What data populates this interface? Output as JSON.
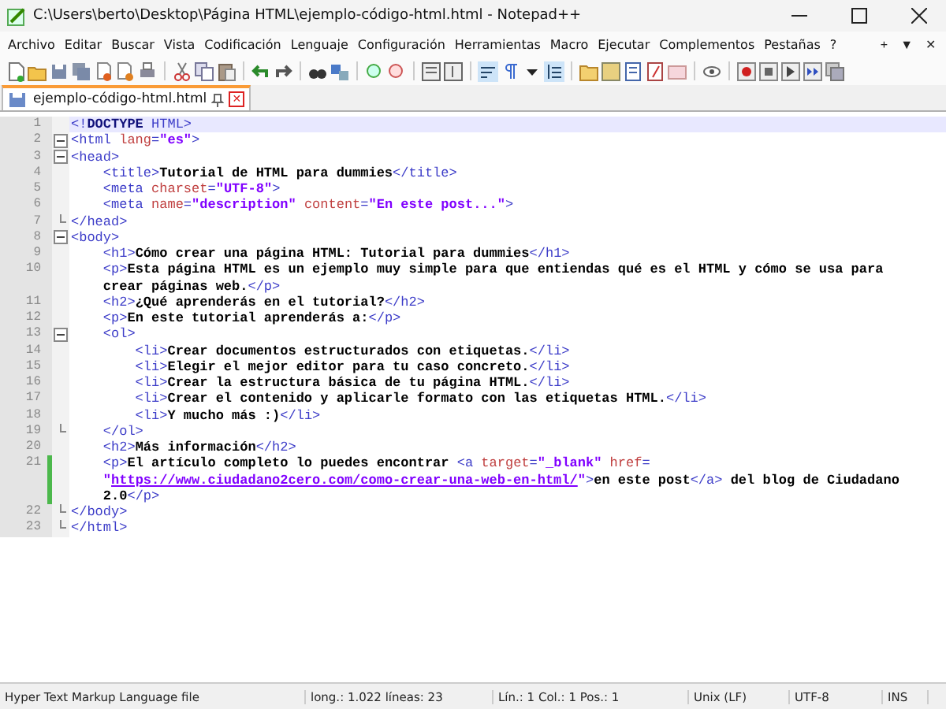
{
  "window": {
    "title": "C:\\Users\\berto\\Desktop\\Página HTML\\ejemplo-código-html.html - Notepad++"
  },
  "menu": [
    "Archivo",
    "Editar",
    "Buscar",
    "Vista",
    "Codificación",
    "Lenguaje",
    "Configuración",
    "Herramientas",
    "Macro",
    "Ejecutar",
    "Complementos",
    "Pestañas",
    "?"
  ],
  "menu_controls": [
    "+",
    "▼",
    "✕"
  ],
  "tabs": [
    {
      "label": "ejemplo-código-html.html",
      "selected": true,
      "pin": "✕"
    }
  ],
  "editor": {
    "lines": [
      {
        "number": "1",
        "current": true,
        "changed": false,
        "fold_start": false,
        "fold_end": false,
        "visual_lines": [
          {
            "segments": [
              {
                "kind": "tag",
                "text": "<!"
              },
              {
                "kind": "doctype",
                "text": "DOCTYPE"
              },
              {
                "kind": "tag",
                "text": " HTML>"
              }
            ]
          }
        ]
      },
      {
        "number": "2",
        "current": false,
        "changed": false,
        "fold_start": true,
        "fold_end": false,
        "visual_lines": [
          {
            "segments": [
              {
                "kind": "tag",
                "text": "<html "
              },
              {
                "kind": "attr",
                "text": "lang"
              },
              {
                "kind": "tag",
                "text": "="
              },
              {
                "kind": "value",
                "text": "\"es\""
              },
              {
                "kind": "tag",
                "text": ">"
              }
            ]
          }
        ]
      },
      {
        "number": "3",
        "current": false,
        "changed": false,
        "fold_start": true,
        "fold_end": false,
        "visual_lines": [
          {
            "segments": [
              {
                "kind": "tag",
                "text": "<head>"
              }
            ]
          }
        ]
      },
      {
        "number": "4",
        "current": false,
        "changed": false,
        "fold_start": false,
        "fold_end": false,
        "visual_lines": [
          {
            "segments": [
              {
                "kind": "tag",
                "text": "    <title>"
              },
              {
                "kind": "text",
                "text": "Tutorial de HTML para dummies"
              },
              {
                "kind": "tag",
                "text": "</title>"
              }
            ]
          }
        ]
      },
      {
        "number": "5",
        "current": false,
        "changed": false,
        "fold_start": false,
        "fold_end": false,
        "visual_lines": [
          {
            "segments": [
              {
                "kind": "tag",
                "text": "    <meta "
              },
              {
                "kind": "attr",
                "text": "charset"
              },
              {
                "kind": "tag",
                "text": "="
              },
              {
                "kind": "value",
                "text": "\"UTF-8\""
              },
              {
                "kind": "tag",
                "text": ">"
              }
            ]
          }
        ]
      },
      {
        "number": "6",
        "current": false,
        "changed": false,
        "fold_start": false,
        "fold_end": false,
        "visual_lines": [
          {
            "segments": [
              {
                "kind": "tag",
                "text": "    <meta "
              },
              {
                "kind": "attr",
                "text": "name"
              },
              {
                "kind": "tag",
                "text": "="
              },
              {
                "kind": "value",
                "text": "\"description\""
              },
              {
                "kind": "attr",
                "text": " content"
              },
              {
                "kind": "tag",
                "text": "="
              },
              {
                "kind": "value",
                "text": "\"En este post...\""
              },
              {
                "kind": "tag",
                "text": ">"
              }
            ]
          }
        ]
      },
      {
        "number": "7",
        "current": false,
        "changed": false,
        "fold_start": false,
        "fold_end": true,
        "visual_lines": [
          {
            "segments": [
              {
                "kind": "tag",
                "text": "</head>"
              }
            ]
          }
        ]
      },
      {
        "number": "8",
        "current": false,
        "changed": false,
        "fold_start": true,
        "fold_end": false,
        "visual_lines": [
          {
            "segments": [
              {
                "kind": "tag",
                "text": "<body>"
              }
            ]
          }
        ]
      },
      {
        "number": "9",
        "current": false,
        "changed": false,
        "fold_start": false,
        "fold_end": false,
        "visual_lines": [
          {
            "segments": [
              {
                "kind": "tag",
                "text": "    <h1>"
              },
              {
                "kind": "text",
                "text": "Cómo crear una página HTML: Tutorial para dummies"
              },
              {
                "kind": "tag",
                "text": "</h1>"
              }
            ]
          }
        ]
      },
      {
        "number": "10",
        "current": false,
        "changed": false,
        "fold_start": false,
        "fold_end": false,
        "visual_lines": [
          {
            "segments": [
              {
                "kind": "tag",
                "text": "    <p>"
              },
              {
                "kind": "text",
                "text": "Esta página HTML es un ejemplo muy simple para que entiendas qué es el HTML y cómo se usa para"
              }
            ]
          },
          {
            "segments": [
              {
                "kind": "text",
                "text": "    crear páginas web."
              },
              {
                "kind": "tag",
                "text": "</p>"
              }
            ]
          }
        ]
      },
      {
        "number": "11",
        "current": false,
        "changed": false,
        "fold_start": false,
        "fold_end": false,
        "visual_lines": [
          {
            "segments": [
              {
                "kind": "tag",
                "text": "    <h2>"
              },
              {
                "kind": "text",
                "text": "¿Qué aprenderás en el tutorial?"
              },
              {
                "kind": "tag",
                "text": "</h2>"
              }
            ]
          }
        ]
      },
      {
        "number": "12",
        "current": false,
        "changed": false,
        "fold_start": false,
        "fold_end": false,
        "visual_lines": [
          {
            "segments": [
              {
                "kind": "tag",
                "text": "    <p>"
              },
              {
                "kind": "text",
                "text": "En este tutorial aprenderás a:"
              },
              {
                "kind": "tag",
                "text": "</p>"
              }
            ]
          }
        ]
      },
      {
        "number": "13",
        "current": false,
        "changed": false,
        "fold_start": true,
        "fold_end": false,
        "visual_lines": [
          {
            "segments": [
              {
                "kind": "tag",
                "text": "    <ol>"
              }
            ]
          }
        ]
      },
      {
        "number": "14",
        "current": false,
        "changed": false,
        "fold_start": false,
        "fold_end": false,
        "visual_lines": [
          {
            "segments": [
              {
                "kind": "tag",
                "text": "        <li>"
              },
              {
                "kind": "text",
                "text": "Crear documentos estructurados con etiquetas."
              },
              {
                "kind": "tag",
                "text": "</li>"
              }
            ]
          }
        ]
      },
      {
        "number": "15",
        "current": false,
        "changed": false,
        "fold_start": false,
        "fold_end": false,
        "visual_lines": [
          {
            "segments": [
              {
                "kind": "tag",
                "text": "        <li>"
              },
              {
                "kind": "text",
                "text": "Elegir el mejor editor para tu caso concreto."
              },
              {
                "kind": "tag",
                "text": "</li>"
              }
            ]
          }
        ]
      },
      {
        "number": "16",
        "current": false,
        "changed": false,
        "fold_start": false,
        "fold_end": false,
        "visual_lines": [
          {
            "segments": [
              {
                "kind": "tag",
                "text": "        <li>"
              },
              {
                "kind": "text",
                "text": "Crear la estructura básica de tu página HTML."
              },
              {
                "kind": "tag",
                "text": "</li>"
              }
            ]
          }
        ]
      },
      {
        "number": "17",
        "current": false,
        "changed": false,
        "fold_start": false,
        "fold_end": false,
        "visual_lines": [
          {
            "segments": [
              {
                "kind": "tag",
                "text": "        <li>"
              },
              {
                "kind": "text",
                "text": "Crear el contenido y aplicarle formato con las etiquetas HTML."
              },
              {
                "kind": "tag",
                "text": "</li>"
              }
            ]
          }
        ]
      },
      {
        "number": "18",
        "current": false,
        "changed": false,
        "fold_start": false,
        "fold_end": false,
        "visual_lines": [
          {
            "segments": [
              {
                "kind": "tag",
                "text": "        <li>"
              },
              {
                "kind": "text",
                "text": "Y mucho más :)"
              },
              {
                "kind": "tag",
                "text": "</li>"
              }
            ]
          }
        ]
      },
      {
        "number": "19",
        "current": false,
        "changed": false,
        "fold_start": false,
        "fold_end": true,
        "visual_lines": [
          {
            "segments": [
              {
                "kind": "tag",
                "text": "    </ol>"
              }
            ]
          }
        ]
      },
      {
        "number": "20",
        "current": false,
        "changed": false,
        "fold_start": false,
        "fold_end": false,
        "visual_lines": [
          {
            "segments": [
              {
                "kind": "tag",
                "text": "    <h2>"
              },
              {
                "kind": "text",
                "text": "Más información"
              },
              {
                "kind": "tag",
                "text": "</h2>"
              }
            ]
          }
        ]
      },
      {
        "number": "21",
        "current": false,
        "changed": true,
        "fold_start": false,
        "fold_end": false,
        "visual_lines": [
          {
            "segments": [
              {
                "kind": "tag",
                "text": "    <p>"
              },
              {
                "kind": "text",
                "text": "El artículo completo lo puedes encontrar "
              },
              {
                "kind": "tag",
                "text": "<a "
              },
              {
                "kind": "attr",
                "text": "target"
              },
              {
                "kind": "tag",
                "text": "="
              },
              {
                "kind": "value",
                "text": "\"_blank\""
              },
              {
                "kind": "attr",
                "text": " href"
              },
              {
                "kind": "tag",
                "text": "="
              }
            ]
          },
          {
            "segments": [
              {
                "kind": "value",
                "text": "    \""
              },
              {
                "kind": "link",
                "text": "https://www.ciudadano2cero.com/como-crear-una-web-en-html/"
              },
              {
                "kind": "value",
                "text": "\""
              },
              {
                "kind": "tag",
                "text": ">"
              },
              {
                "kind": "text",
                "text": "en este post"
              },
              {
                "kind": "tag",
                "text": "</a>"
              },
              {
                "kind": "text",
                "text": " del blog de Ciudadano"
              }
            ]
          },
          {
            "segments": [
              {
                "kind": "text",
                "text": "    2.0"
              },
              {
                "kind": "tag",
                "text": "</p>"
              }
            ]
          }
        ]
      },
      {
        "number": "22",
        "current": false,
        "changed": false,
        "fold_start": false,
        "fold_end": true,
        "visual_lines": [
          {
            "segments": [
              {
                "kind": "tag",
                "text": "</body>"
              }
            ]
          }
        ]
      },
      {
        "number": "23",
        "current": false,
        "changed": false,
        "fold_start": false,
        "fold_end": true,
        "visual_lines": [
          {
            "segments": [
              {
                "kind": "tag",
                "text": "</html>"
              }
            ]
          }
        ]
      }
    ]
  },
  "status_bar": {
    "file_type": "Hyper Text Markup Language file",
    "length": "long.: 1.022",
    "lines": "líneas: 23",
    "line": "Lín.: 1",
    "column": "Col.: 1",
    "position": "Pos.: 1",
    "eol": "Unix (LF)",
    "encoding": "UTF-8",
    "mode": "INS"
  }
}
